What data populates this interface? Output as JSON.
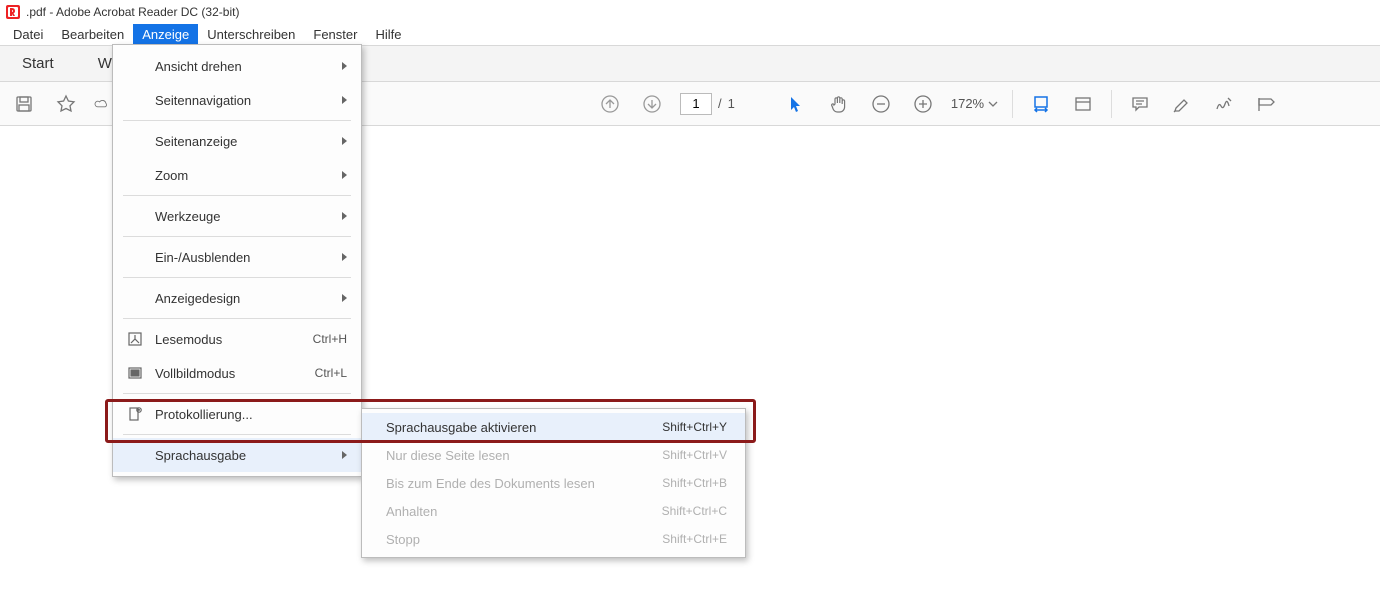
{
  "titlebar": {
    "title": ".pdf - Adobe Acrobat Reader DC (32-bit)"
  },
  "menubar": {
    "items": [
      {
        "label": "Datei"
      },
      {
        "label": "Bearbeiten"
      },
      {
        "label": "Anzeige"
      },
      {
        "label": "Unterschreiben"
      },
      {
        "label": "Fenster"
      },
      {
        "label": "Hilfe"
      }
    ]
  },
  "tabs": {
    "start": "Start",
    "werkzeuge_prefix": "Wer"
  },
  "toolbar": {
    "page_current": "1",
    "page_sep": "/",
    "page_total": "1",
    "zoom_value": "172%"
  },
  "dropdown": {
    "items": [
      {
        "label": "Ansicht drehen",
        "arrow": true
      },
      {
        "label": "Seitennavigation",
        "arrow": true
      },
      {
        "sep": true
      },
      {
        "label": "Seitenanzeige",
        "arrow": true
      },
      {
        "label": "Zoom",
        "arrow": true
      },
      {
        "sep": true
      },
      {
        "label": "Werkzeuge",
        "arrow": true
      },
      {
        "sep": true
      },
      {
        "label": "Ein-/Ausblenden",
        "arrow": true
      },
      {
        "sep": true
      },
      {
        "label": "Anzeigedesign",
        "arrow": true
      },
      {
        "sep": true
      },
      {
        "icon": "reading-mode",
        "label": "Lesemodus",
        "shortcut": "Ctrl+H"
      },
      {
        "icon": "fullscreen",
        "label": "Vollbildmodus",
        "shortcut": "Ctrl+L"
      },
      {
        "sep": true
      },
      {
        "icon": "protocol",
        "label": "Protokollierung..."
      },
      {
        "sep": true
      },
      {
        "label": "Sprachausgabe",
        "arrow": true,
        "hover": true
      }
    ]
  },
  "submenu": {
    "items": [
      {
        "label": "Sprachausgabe aktivieren",
        "shortcut": "Shift+Ctrl+Y",
        "enabled": true,
        "hover": true
      },
      {
        "label": "Nur diese Seite lesen",
        "shortcut": "Shift+Ctrl+V",
        "enabled": false
      },
      {
        "label": "Bis zum Ende des Dokuments lesen",
        "shortcut": "Shift+Ctrl+B",
        "enabled": false
      },
      {
        "label": "Anhalten",
        "shortcut": "Shift+Ctrl+C",
        "enabled": false
      },
      {
        "label": "Stopp",
        "shortcut": "Shift+Ctrl+E",
        "enabled": false
      }
    ]
  }
}
